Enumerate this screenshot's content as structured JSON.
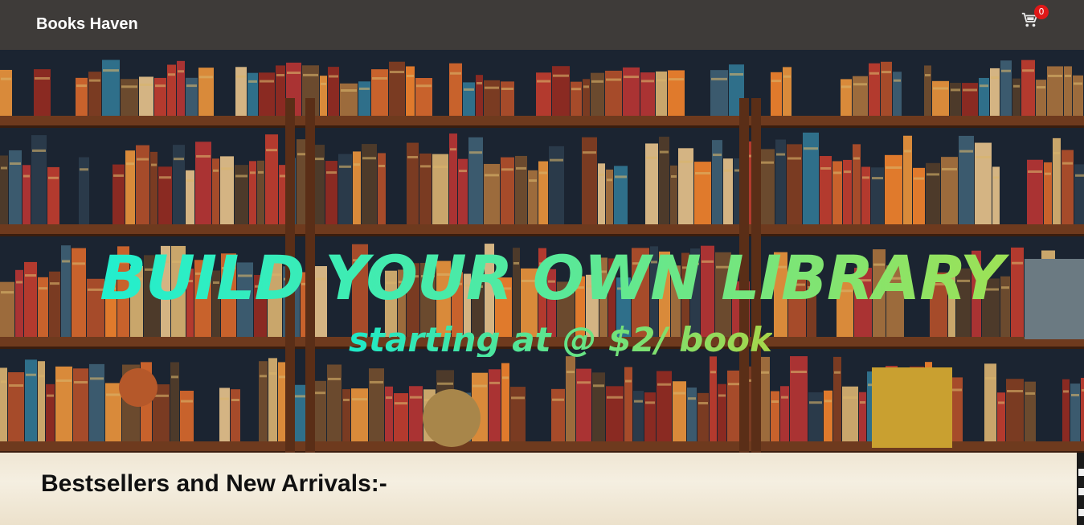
{
  "navbar": {
    "brand": "Books Haven",
    "cart_count": "0",
    "cart_icon": "shopping-cart-icon"
  },
  "hero": {
    "title": "BUILD YOUR OWN LIBRARY",
    "subtitle": "starting at @ $2/ book",
    "image": "bookshelf-background"
  },
  "section": {
    "title": "Bestsellers and New Arrivals:-"
  },
  "colors": {
    "navbar_bg": "#3e3b39",
    "badge": "#e01818",
    "hero_gradient_start": "#17f0d9",
    "hero_gradient_end": "#a9e04a",
    "section_bg": "#efe6d3"
  }
}
